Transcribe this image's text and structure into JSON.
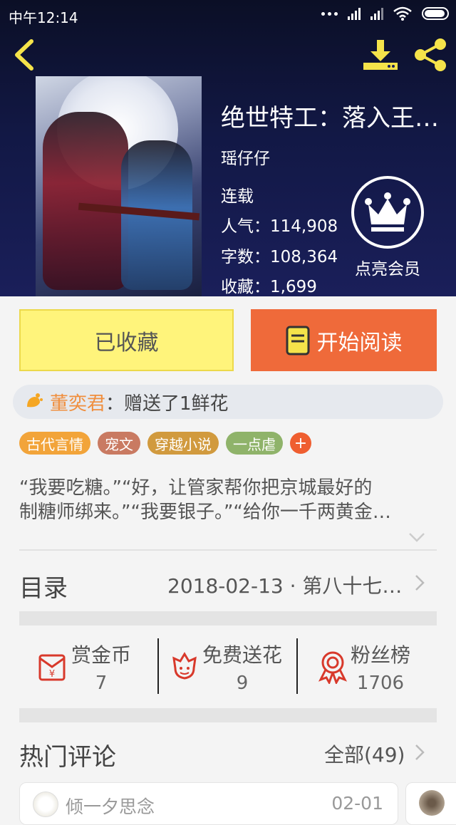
{
  "status_bar": {
    "time": "中午12:14"
  },
  "book": {
    "title": "绝世特工：落入王…",
    "author": "瑶仔仔",
    "status": "连载",
    "popularity": "人气：114,908",
    "word_count": "字数：108,364",
    "favorites": "收藏：1,699",
    "vip_label": "点亮会员"
  },
  "actions": {
    "favorited_label": "已收藏",
    "read_label": "开始阅读"
  },
  "gift": {
    "name": "董奕君",
    "message": "：赠送了1鲜花"
  },
  "tags": [
    {
      "label": "古代言情",
      "color": "#f2a43a"
    },
    {
      "label": "宠文",
      "color": "#c97a62"
    },
    {
      "label": "穿越小说",
      "color": "#d19a3e"
    },
    {
      "label": "一点虐",
      "color": "#8fb36a"
    }
  ],
  "tag_add": "+",
  "description": {
    "line1": "“我要吃糖。”“好，让管家帮你把京城最好的",
    "line2": "制糖师绑来。”“我要银子。”“给你一千两黄金…"
  },
  "toc": {
    "label": "目录",
    "latest": "2018-02-13 · 第八十七…"
  },
  "stats": [
    {
      "label": "赏金币",
      "value": "7",
      "icon": "red-envelope-icon"
    },
    {
      "label": "免费送花",
      "value": "9",
      "icon": "flower-icon"
    },
    {
      "label": "粉丝榜",
      "value": "1706",
      "icon": "ribbon-medal-icon"
    }
  ],
  "comments": {
    "header": "热门评论",
    "all": "全部(49)",
    "items": [
      {
        "user": "倾一夕思念",
        "date": "02-01"
      }
    ]
  },
  "colors": {
    "accent_orange": "#ef6a3a",
    "fav_yellow": "#fff47b",
    "icon_yellow": "#f5e34a",
    "stat_red": "#d8392b"
  }
}
